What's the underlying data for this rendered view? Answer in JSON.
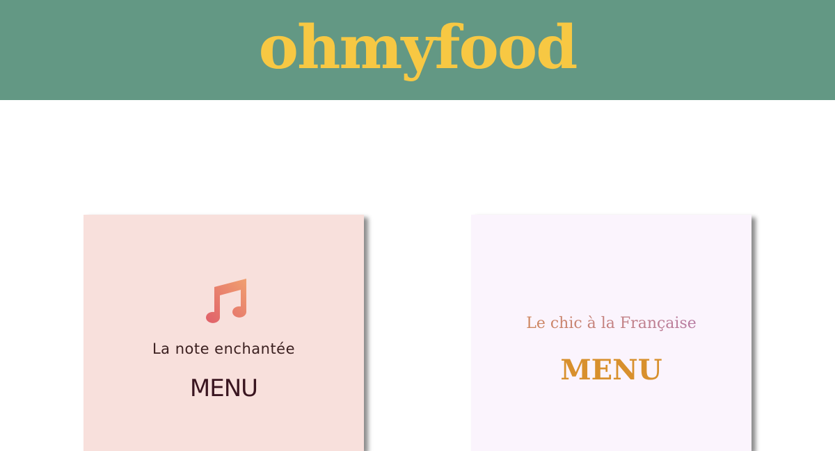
{
  "header": {
    "logo": "ohmyfood"
  },
  "restaurants": [
    {
      "icon": "music-note-icon",
      "name": "La note enchantée",
      "menu_label": "MENU"
    },
    {
      "name": "Le chic à la Française",
      "menu_label": "MENU"
    }
  ],
  "colors": {
    "header_bg": "#639884",
    "logo": "#f7c843",
    "card_1_bg": "#f8e0dc",
    "card_2_bg": "#fbf4fd",
    "card_2_menu": "#d8902d"
  }
}
